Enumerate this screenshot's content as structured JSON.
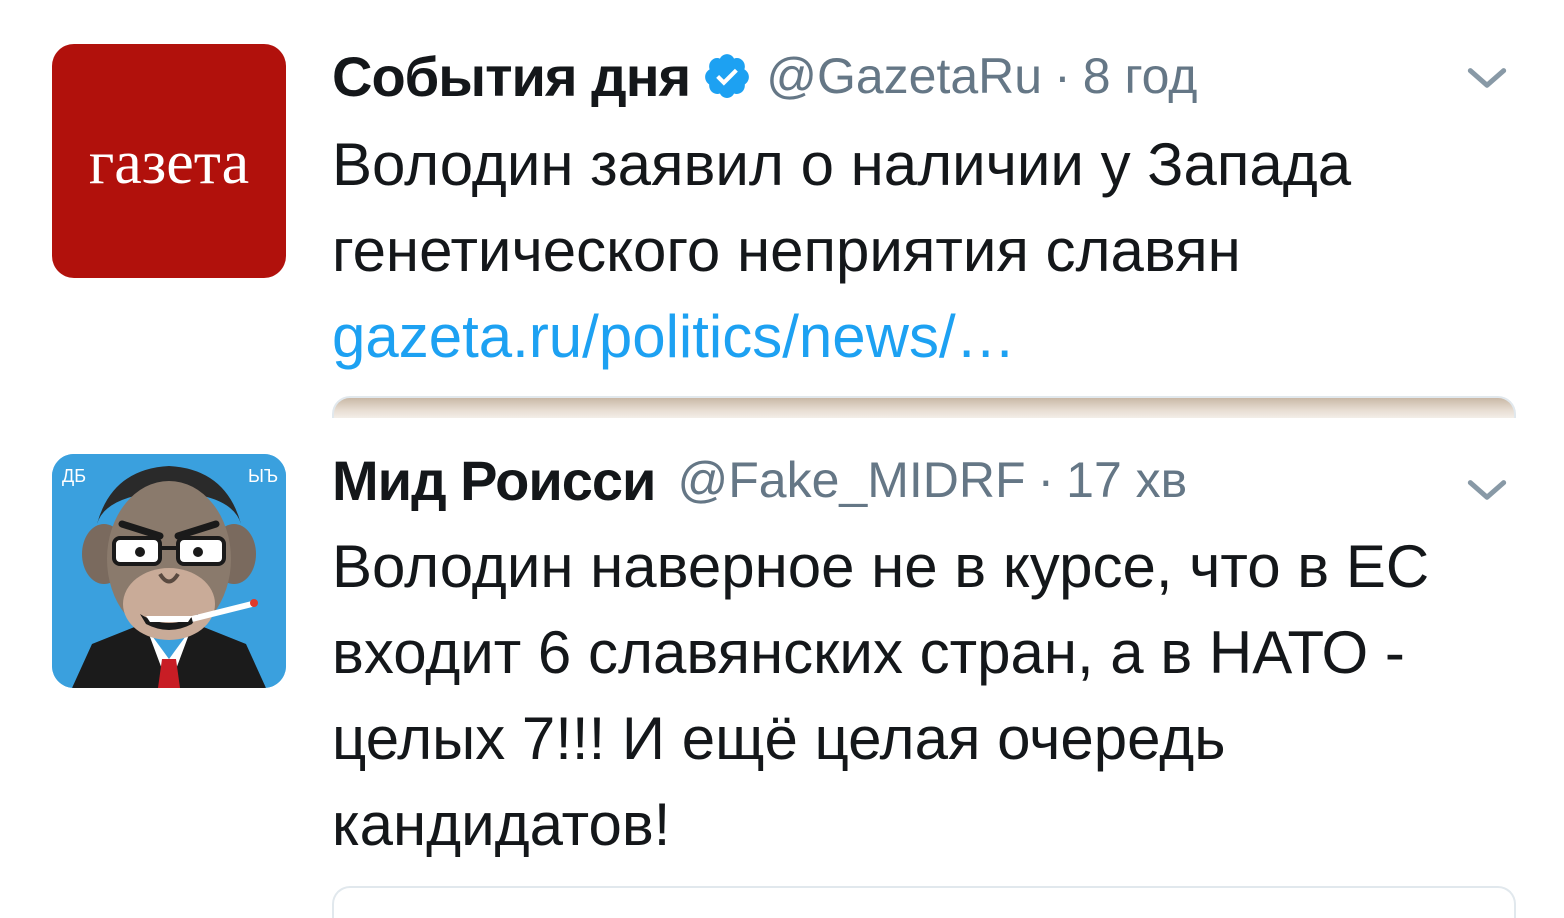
{
  "tweets": [
    {
      "display_name": "События дня",
      "verified": true,
      "handle": "@GazetaRu",
      "separator": "·",
      "time": "8 год",
      "avatar_label": "газета",
      "text_lines": [
        "Володин заявил о наличии у Запада",
        "генетического неприятия славян"
      ],
      "link": "gazeta.ru/politics/news/…",
      "avatar_color": "#b1110c",
      "avatar_icon": "gazeta-logo"
    },
    {
      "display_name": "Мид Роисси",
      "verified": false,
      "handle": "@Fake_MIDRF",
      "separator": "·",
      "time": "17 хв",
      "avatar_icon": "caricature-avatar",
      "text_lines": [
        "Володин наверное не в курсе, что в ЕС",
        "входит 6 славянских стран, а в НАТО -",
        "целых 7!!! И ещё целая очередь",
        "кандидатов!"
      ],
      "avatar_color": "#3aa0de"
    }
  ],
  "colors": {
    "link": "#1da1f2",
    "verified": "#1da1f2",
    "secondary_text": "#657786",
    "primary_text": "#14171a"
  }
}
